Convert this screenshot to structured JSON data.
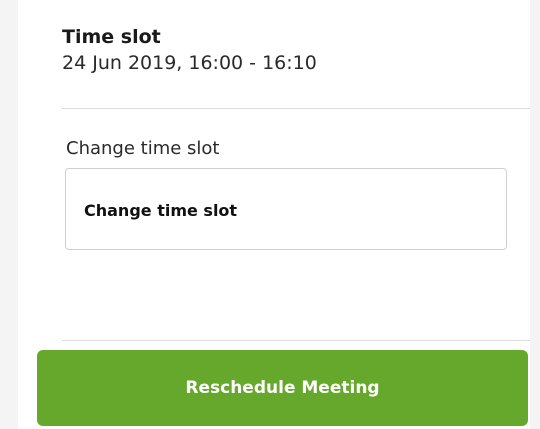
{
  "time_slot": {
    "heading": "Time slot",
    "value": "24 Jun 2019, 16:00 - 16:10"
  },
  "change_time_slot": {
    "label": "Change time slot",
    "select_value": "Change time slot"
  },
  "actions": {
    "reschedule_label": "Reschedule Meeting"
  },
  "colors": {
    "primary_button": "#66a82c",
    "background": "#f4f4f4",
    "card": "#ffffff"
  }
}
